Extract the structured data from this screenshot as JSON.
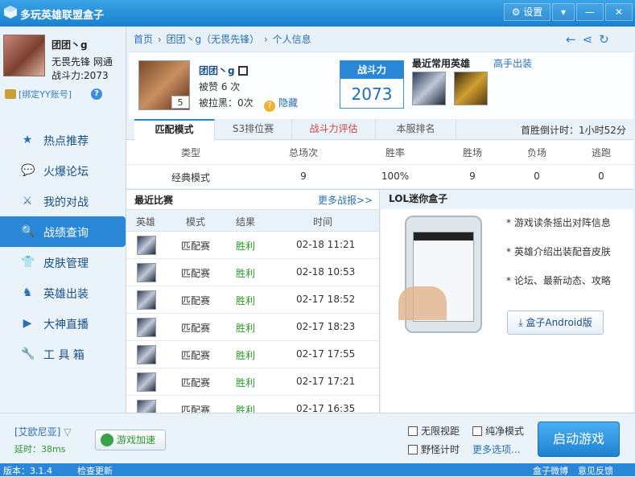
{
  "window": {
    "title": "多玩英雄联盟盒子",
    "settings_label": "⚙ 设置",
    "menu_label": "▾",
    "min_label": "—",
    "close_label": "✕"
  },
  "profile": {
    "name": "团团丶g",
    "server": "无畏先锋 网通",
    "power": "战斗力:2073",
    "yy_bind": "[绑定YY账号]",
    "help": "?"
  },
  "nav": [
    {
      "label": "热点推荐",
      "icon": "star-icon",
      "glyph": "★"
    },
    {
      "label": "火爆论坛",
      "icon": "chat-icon",
      "glyph": "💬"
    },
    {
      "label": "我的对战",
      "icon": "battle-icon",
      "glyph": "⚔"
    },
    {
      "label": "战绩查询",
      "icon": "search-icon",
      "glyph": "🔍"
    },
    {
      "label": "皮肤管理",
      "icon": "skin-icon",
      "glyph": "👕"
    },
    {
      "label": "英雄出装",
      "icon": "hero-icon",
      "glyph": "♞"
    },
    {
      "label": "大神直播",
      "icon": "play-icon",
      "glyph": "▶"
    },
    {
      "label": "工 具 箱",
      "icon": "tools-icon",
      "glyph": "🔧"
    }
  ],
  "breadcrumb": {
    "home": "首页",
    "player": "团团丶g（无畏先锋）",
    "page": "个人信息",
    "sep": "›"
  },
  "card": {
    "name": "团团丶g",
    "level": "5",
    "likes": "被赞 6 次",
    "block": "被拉黑：0次",
    "hide_label": "隐藏",
    "power_title": "战斗力",
    "power_value": "2073",
    "fav_title": "最近常用英雄",
    "expert_link": "高手出装"
  },
  "tabs": {
    "items": [
      "匹配模式",
      "S3排位赛",
      "战斗力评估",
      "本服排名"
    ],
    "countdown": "首胜倒计时：1小时52分"
  },
  "stats": {
    "headers": [
      "类型",
      "总场次",
      "胜率",
      "胜场",
      "负场",
      "逃跑"
    ],
    "row": [
      "经典模式",
      "9",
      "100%",
      "9",
      "0",
      "0"
    ]
  },
  "recent": {
    "title": "最近比赛",
    "more": "更多战报>>",
    "headers": [
      "英雄",
      "模式",
      "结果",
      "时间"
    ],
    "matches": [
      {
        "mode": "匹配赛",
        "result": "胜利",
        "time": "02-18 11:21"
      },
      {
        "mode": "匹配赛",
        "result": "胜利",
        "time": "02-18 10:53"
      },
      {
        "mode": "匹配赛",
        "result": "胜利",
        "time": "02-17 18:52"
      },
      {
        "mode": "匹配赛",
        "result": "胜利",
        "time": "02-17 18:23"
      },
      {
        "mode": "匹配赛",
        "result": "胜利",
        "time": "02-17 17:55"
      },
      {
        "mode": "匹配赛",
        "result": "胜利",
        "time": "02-17 17:21"
      },
      {
        "mode": "匹配赛",
        "result": "胜利",
        "time": "02-17 16:35"
      }
    ]
  },
  "minibox": {
    "title": "LOL迷你盒子",
    "features": [
      "* 游戏读条摇出对阵信息",
      "* 英雄介绍出装配音皮肤",
      "* 论坛、最新动态、攻略"
    ],
    "android_btn": "盒子Android版"
  },
  "footer": {
    "server": "[艾欧尼亚]",
    "latency": "延时：38ms",
    "accel": "游戏加速",
    "options": [
      "无限视距",
      "纯净模式",
      "野怪计时"
    ],
    "more_options": "更多选项...",
    "start": "启动游戏"
  },
  "status": {
    "version": "版本：3.1.4",
    "update": "检查更新",
    "weibo": "盒子微博",
    "feedback": "意见反馈"
  }
}
